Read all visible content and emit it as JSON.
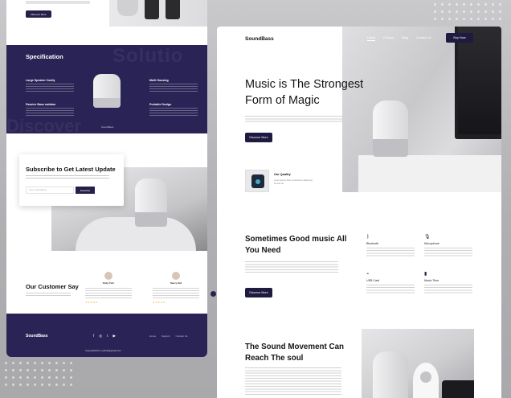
{
  "left": {
    "top_button": "Discover More",
    "spec": {
      "title": "Specification",
      "ghost_word": "Solutio",
      "ghost_word2": "Discover",
      "features": [
        {
          "title": "Large Speaker Cavity"
        },
        {
          "title": "Passive Bass radiator"
        },
        {
          "title": "Multi Housing"
        },
        {
          "title": "Portable Design"
        }
      ],
      "speaker_name": "SoundBass"
    },
    "subscribe": {
      "title": "Subscribe to Get Latest Update",
      "input_placeholder": "Your email address",
      "button": "Subscribe"
    },
    "customers": {
      "title": "Our Customer Say",
      "reviews": [
        {
          "name": "Rizky Putri",
          "stars": "★★★★★"
        },
        {
          "name": "Nancy Dell",
          "stars": "★★★★★"
        }
      ]
    },
    "footer": {
      "logo": "SoundBass",
      "socials": [
        "f",
        "◎",
        "t",
        "▶"
      ],
      "links": [
        "Home",
        "Support",
        "Contact Us"
      ],
      "copyright": "Copyright2021 | update@gmail.com"
    }
  },
  "right": {
    "nav": {
      "logo": "SoundBass",
      "links": [
        "Home",
        "Product",
        "Blog",
        "Contact Us"
      ],
      "active": "Home",
      "button": "Buy Now"
    },
    "hero": {
      "title": "Music is The Strongest Form of Magic",
      "button": "Discover More"
    },
    "quality": {
      "title": "Our Quality",
      "text": "Lorem ipsum dolor consectetur adipiscing elit sed do."
    },
    "section2": {
      "title": "Sometimes Good music All You Need",
      "button": "Discover More",
      "features": [
        {
          "icon": "bluetooth-icon",
          "glyph": "ᛒ",
          "title": "Bluetooth"
        },
        {
          "icon": "microphone-icon",
          "glyph": "🎙",
          "title": "Microphone"
        },
        {
          "icon": "usb-icon",
          "glyph": "⌁",
          "title": "USB Card"
        },
        {
          "icon": "music-time-icon",
          "glyph": "▮",
          "title": "Music Time"
        }
      ]
    },
    "section3": {
      "title": "The Sound Movement Can Reach The soul"
    }
  },
  "colors": {
    "brand": "#2a2456",
    "button": "#1e1a40",
    "star": "#e9b53c"
  }
}
